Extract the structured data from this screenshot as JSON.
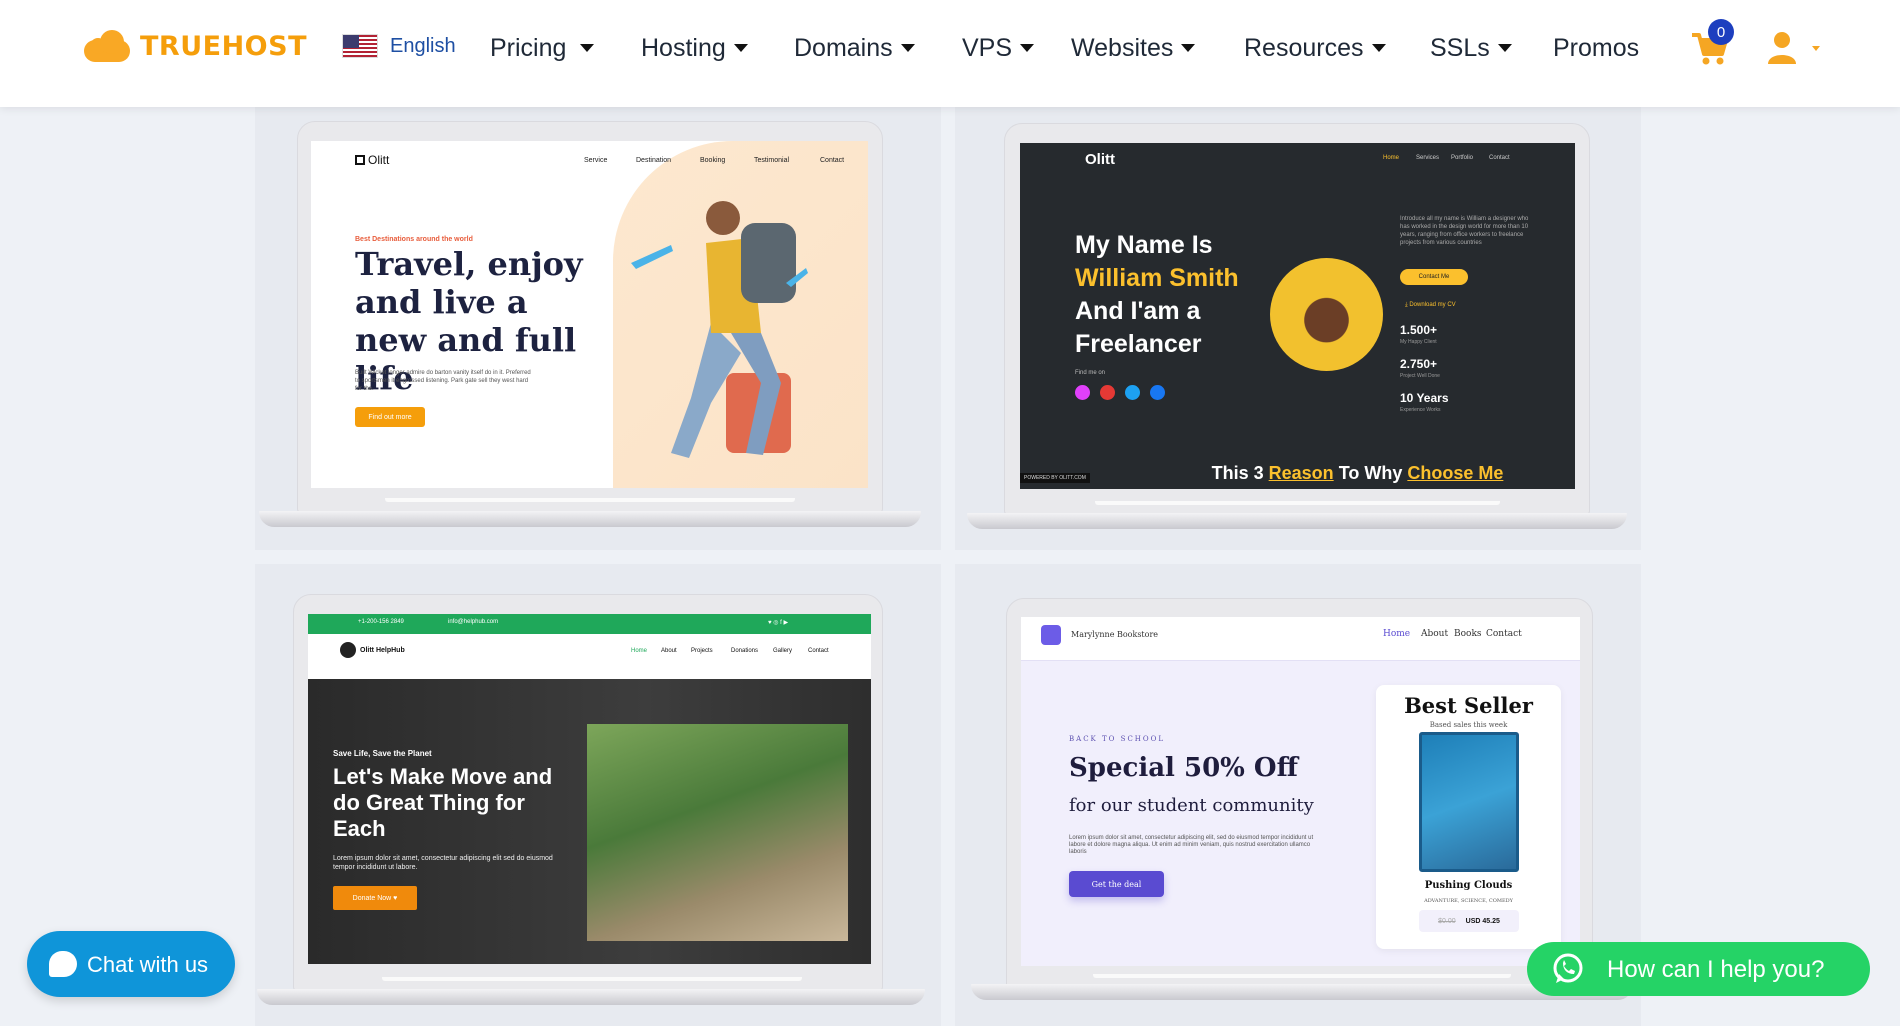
{
  "header": {
    "logo_text": "TRUEHOST",
    "language": "English",
    "nav": [
      {
        "label": "Pricing"
      },
      {
        "label": "Hosting"
      },
      {
        "label": "Domains"
      },
      {
        "label": "VPS"
      },
      {
        "label": "Websites"
      },
      {
        "label": "Resources"
      },
      {
        "label": "SSLs"
      },
      {
        "label": "Promos"
      }
    ],
    "cart_count": "0",
    "colors": {
      "accent": "#f59e0b",
      "badge": "#1d3fbf"
    }
  },
  "cards": {
    "travel": {
      "brand": "Olitt",
      "nav": [
        "Service",
        "Destination",
        "Booking",
        "Testimonial",
        "Contact"
      ],
      "eyebrow": "Best Destinations around the world",
      "headline": "Travel, enjoy and live a new and full life",
      "para": "Built Wicket longer admire do barton vanity itself do in it. Preferred to sportsmen it engrossed listening. Park gate sell they west hard for the.",
      "cta": "Find out more"
    },
    "freelancer": {
      "brand": "Olitt",
      "nav": [
        "Home",
        "Services",
        "Portfolio",
        "Contact"
      ],
      "h_line1": "My Name Is",
      "h_line2": "William Smith",
      "h_line3": "And I'am a",
      "h_line4": "Freelancer",
      "find_me": "Find me on",
      "bio": "Introduce all my name is William a designer who has worked in the design world for more than 10 years, ranging from office workers to freelance projects from various countries",
      "contact_btn": "Contact Me",
      "download": "Download my CV",
      "stats": [
        {
          "value": "1.500+",
          "label": "My Happy Client"
        },
        {
          "value": "2.750+",
          "label": "Project Well Done"
        },
        {
          "value": "10 Years",
          "label": "Experience Works"
        }
      ],
      "bottom_prefix": "This 3",
      "bottom_reason": "Reason",
      "bottom_mid": "To Why",
      "bottom_choose": "Choose Me",
      "powered": "POWERED BY OLITT.COM"
    },
    "charity": {
      "phone": "+1-200-156 2849",
      "email": "info@helphub.com",
      "brand": "Olitt HelpHub",
      "nav": [
        "Home",
        "About",
        "Projects",
        "Donations",
        "Gallery",
        "Contact"
      ],
      "eyebrow": "Save Life, Save the Planet",
      "headline": "Let's Make Move and do Great Thing for Each",
      "para": "Lorem ipsum dolor sit amet, consectetur adipiscing elit sed do eiusmod tempor incididunt ut labore.",
      "cta": "Donate Now"
    },
    "bookstore": {
      "brand": "Marylynne Bookstore",
      "nav": [
        "Home",
        "About",
        "Books",
        "Contact"
      ],
      "eyebrow": "BACK TO SCHOOL",
      "headline": "Special 50% Off",
      "subhead": "for our student community",
      "para": "Lorem ipsum dolor sit amet, consectetur adipiscing elit, sed do eiusmod tempor incididunt ut labore et dolore magna aliqua. Ut enim ad minim veniam, quis nostrud exercitation ullamco laboris",
      "cta": "Get the deal",
      "best_seller": "Best Seller",
      "best_sub": "Based sales this week",
      "book_title": "Pushing Clouds",
      "book_genre": "ADVANTURE, SCIENCE, COMEDY",
      "old_price": "$0.00",
      "price": "USD 45.25"
    }
  },
  "widgets": {
    "chat_label": "Chat with us",
    "whatsapp_label": "How can I help you?"
  }
}
